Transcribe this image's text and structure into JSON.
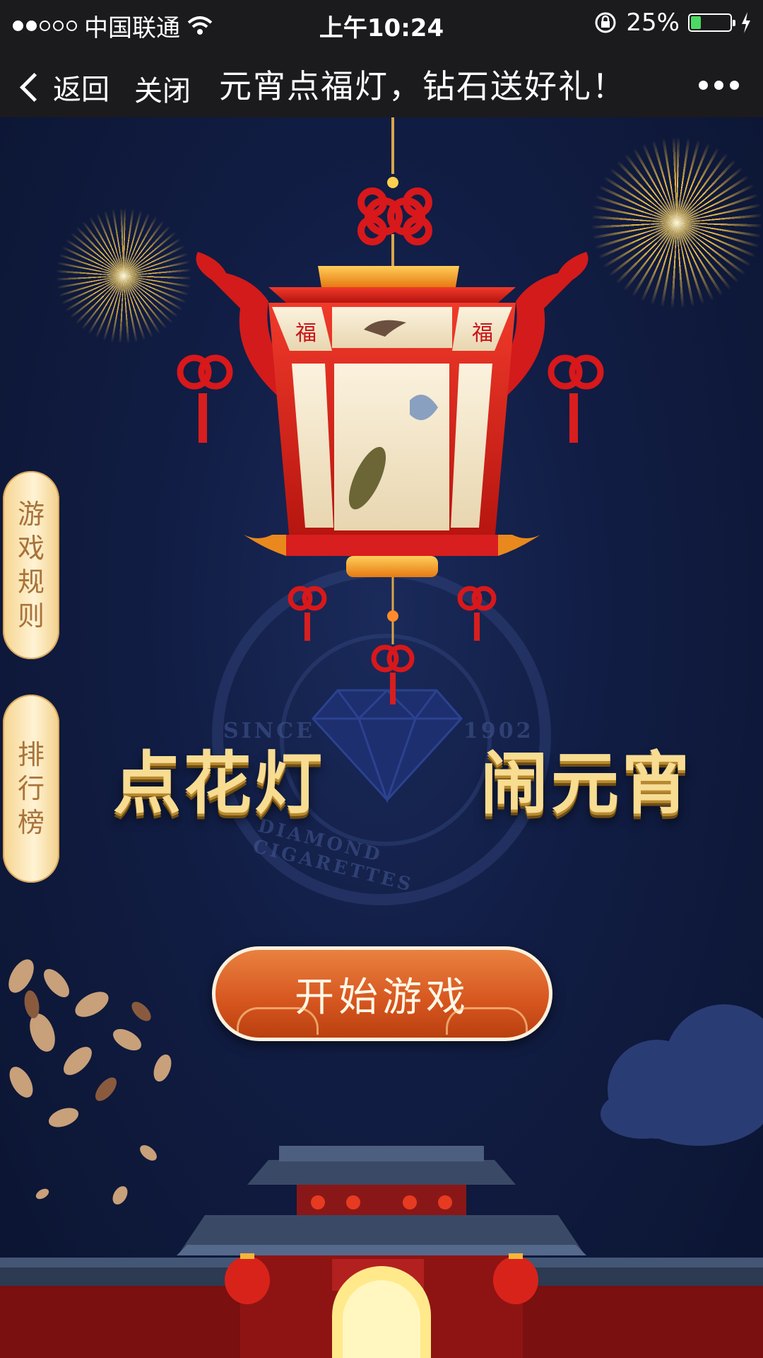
{
  "status_bar": {
    "carrier": "中国联通",
    "time": "上午10:24",
    "battery": "25%",
    "battery_level": 0.25
  },
  "nav": {
    "back_label": "返回",
    "close_label": "关闭",
    "title": "元宵点福灯，钻石送好礼！"
  },
  "side_buttons": {
    "rules": [
      "游",
      "戏",
      "规",
      "则"
    ],
    "ranking": [
      "排",
      "行",
      "榜"
    ]
  },
  "headline": {
    "left": "点花灯",
    "right": "闹元宵"
  },
  "emblem": {
    "since": "SINCE",
    "year": "1902",
    "ring": "DIAMOND CIGARETTES"
  },
  "start_button": {
    "label": "开始游戏"
  },
  "lantern_chars": [
    "福",
    "福"
  ],
  "colors": {
    "background": "#111d44",
    "accent_gold": "#f7dc92",
    "button_orange": "#d6551f",
    "lantern_red": "#d81e1e"
  }
}
